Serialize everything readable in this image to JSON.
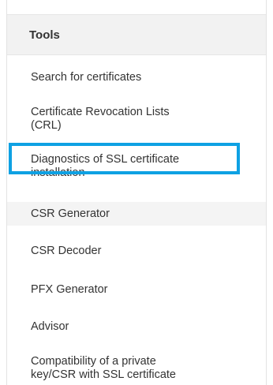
{
  "panel": {
    "title": "Tools"
  },
  "menu": {
    "items": [
      {
        "label": "Search for certificates"
      },
      {
        "label": "Certificate Revocation Lists\n(CRL)"
      },
      {
        "label": "Diagnostics of SSL certificate\ninstallation"
      },
      {
        "label": "CSR Generator"
      },
      {
        "label": "CSR Decoder"
      },
      {
        "label": "PFX Generator"
      },
      {
        "label": "Advisor"
      },
      {
        "label": "Compatibility of a private\nkey/CSR with SSL certificate"
      }
    ],
    "active_item": "CSR Generator",
    "focus_color": "#0ea1e3"
  }
}
